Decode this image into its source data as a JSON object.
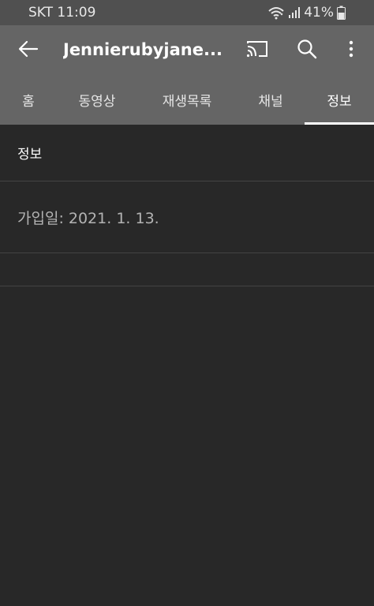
{
  "status_bar": {
    "carrier_time": "SKT 11:09",
    "battery": "41%",
    "icons": [
      "wifi-icon",
      "signal-icon",
      "battery-icon"
    ]
  },
  "app_bar": {
    "title": "Jennierubyjane...",
    "icons": [
      "back-arrow-icon",
      "cast-icon",
      "search-icon",
      "more-vert-icon"
    ]
  },
  "tabs": [
    {
      "label": "홈",
      "active": false
    },
    {
      "label": "동영상",
      "active": false
    },
    {
      "label": "재생목록",
      "active": false
    },
    {
      "label": "채널",
      "active": false
    },
    {
      "label": "정보",
      "active": true
    }
  ],
  "about": {
    "section_title": "정보",
    "joined": "가입일: 2021. 1. 13."
  },
  "colors": {
    "app_bar": "#656565",
    "status_bar": "#505050",
    "background": "#282828",
    "divider": "#444444"
  }
}
